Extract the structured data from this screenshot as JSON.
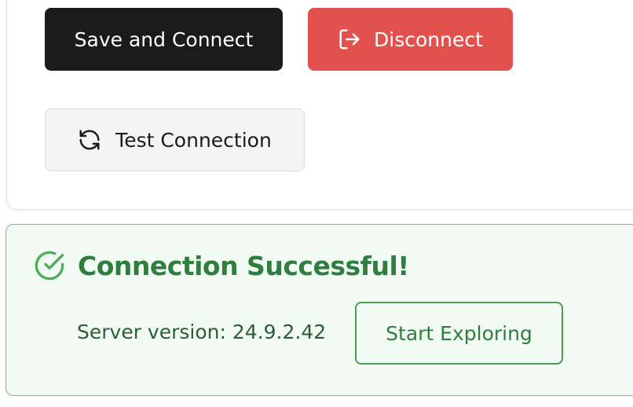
{
  "actions": {
    "save_connect_label": "Save and Connect",
    "disconnect_label": "Disconnect",
    "test_connection_label": "Test Connection"
  },
  "alert": {
    "title": "Connection Successful!",
    "server_version_label": "Server version:",
    "server_version_value": "24.9.2.42",
    "start_exploring_label": "Start Exploring"
  },
  "icons": {
    "disconnect": "logout-icon",
    "test_connection": "refresh-icon",
    "success": "check-circle-icon"
  },
  "colors": {
    "primary": "#1b1b1b",
    "danger": "#e1524f",
    "success": "#2f7d3f",
    "success_bg": "#f1fbf3"
  }
}
